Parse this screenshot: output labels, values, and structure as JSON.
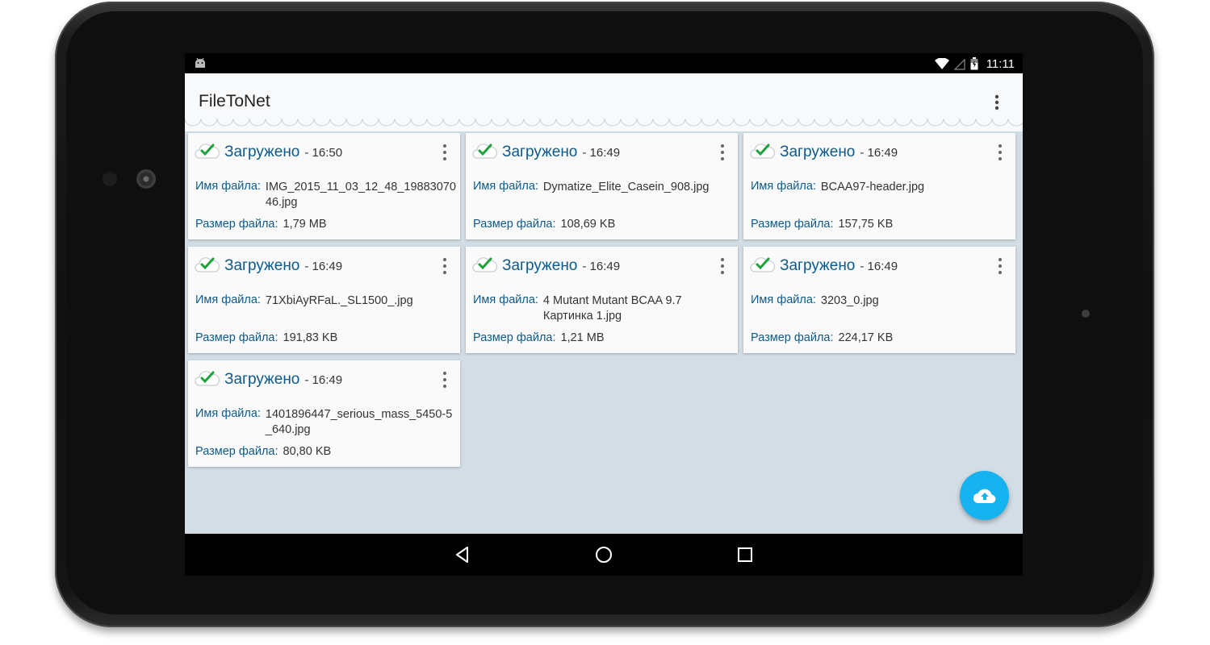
{
  "status_bar": {
    "time": "11:11"
  },
  "app": {
    "title": "FileToNet"
  },
  "labels": {
    "file_name": "Имя файла:",
    "file_size": "Размер файла:"
  },
  "cards": [
    {
      "status": "Загружено",
      "time": "- 16:50",
      "file_name": "IMG_2015_11_03_12_48_1988307046.jpg",
      "file_size": "1,79 MB"
    },
    {
      "status": "Загружено",
      "time": "- 16:49",
      "file_name": "Dymatize_Elite_Casein_908.jpg",
      "file_size": "108,69 KB"
    },
    {
      "status": "Загружено",
      "time": "- 16:49",
      "file_name": "BCAA97-header.jpg",
      "file_size": "157,75 KB"
    },
    {
      "status": "Загружено",
      "time": "- 16:49",
      "file_name": "71XbiAyRFaL._SL1500_.jpg",
      "file_size": "191,83 KB"
    },
    {
      "status": "Загружено",
      "time": "- 16:49",
      "file_name": "4 Mutant Mutant BCAA 9.7 Картинка 1.jpg",
      "file_size": "1,21 MB"
    },
    {
      "status": "Загружено",
      "time": "- 16:49",
      "file_name": "3203_0.jpg",
      "file_size": "224,17 KB"
    },
    {
      "status": "Загружено",
      "time": "- 16:49",
      "file_name": "1401896447_serious_mass_5450-5_640.jpg",
      "file_size": "80,80 KB"
    }
  ],
  "icons": {
    "status": [
      "android-icon",
      "wifi-icon",
      "signal-icon",
      "battery-icon"
    ],
    "card": [
      "cloud-check-icon",
      "more-vert-icon"
    ],
    "fab": "cloud-upload-icon",
    "nav": [
      "back-icon",
      "home-icon",
      "recents-icon"
    ]
  },
  "colors": {
    "accent": "#16b3f0",
    "label": "#0d5a8a",
    "check": "#1aa33a",
    "background": "#d3dde5"
  }
}
